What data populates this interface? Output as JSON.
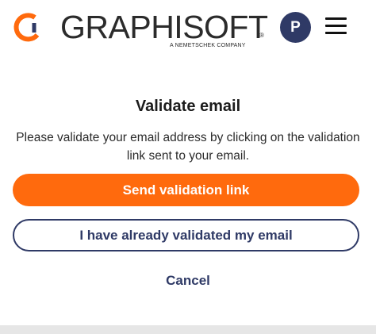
{
  "header": {
    "brand": {
      "name": "GRAPHISOFT",
      "registered": "®",
      "tagline": "A NEMETSCHEK COMPANY",
      "mark_colors": [
        "#ff6a0d",
        "#2f3a66"
      ]
    },
    "avatar": {
      "initial": "P",
      "color": "#2f3a66"
    },
    "menu_icon": "hamburger-menu-icon"
  },
  "main": {
    "title": "Validate email",
    "message": "Please validate your email address by clicking on the validation link sent to your email.",
    "primary_button": "Send validation link",
    "secondary_button": "I have already validated my email",
    "cancel_link": "Cancel"
  },
  "colors": {
    "accent": "#ff6a0d",
    "brand_navy": "#2f3a66",
    "text": "#2a2a2a",
    "footer": "#e6e6e6"
  }
}
